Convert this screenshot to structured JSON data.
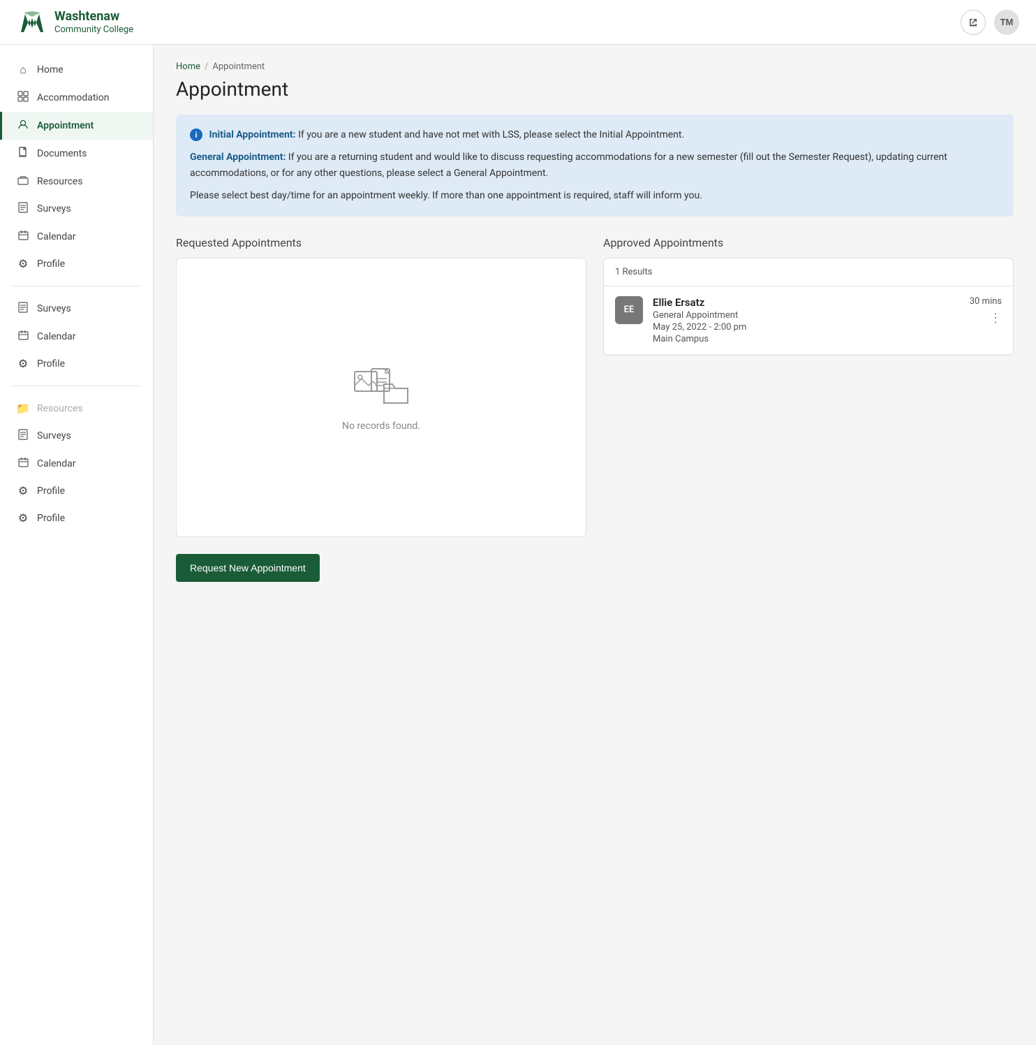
{
  "navbar": {
    "logo_line1": "Washtenaw",
    "logo_line2": "Community College",
    "avatar_initials": "TM"
  },
  "sidebar": {
    "items": [
      {
        "id": "home",
        "label": "Home",
        "icon": "🏠",
        "active": false
      },
      {
        "id": "accommodation",
        "label": "Accommodation",
        "icon": "⊞",
        "active": false
      },
      {
        "id": "appointment",
        "label": "Appointment",
        "icon": "👤",
        "active": true
      },
      {
        "id": "documents",
        "label": "Documents",
        "icon": "📄",
        "active": false
      },
      {
        "id": "resources",
        "label": "Resources",
        "icon": "📁",
        "active": false
      },
      {
        "id": "surveys",
        "label": "Surveys",
        "icon": "📋",
        "active": false
      },
      {
        "id": "calendar",
        "label": "Calendar",
        "icon": "📅",
        "active": false
      },
      {
        "id": "profile",
        "label": "Profile",
        "icon": "⚙",
        "active": false
      }
    ],
    "secondary_items": [
      {
        "id": "surveys2",
        "label": "Surveys",
        "icon": "📋"
      },
      {
        "id": "calendar2",
        "label": "Calendar",
        "icon": "📅"
      },
      {
        "id": "profile2",
        "label": "Profile",
        "icon": "⚙"
      }
    ]
  },
  "breadcrumb": {
    "home": "Home",
    "separator": "/",
    "current": "Appointment"
  },
  "page": {
    "title": "Appointment"
  },
  "info_box": {
    "icon": "i",
    "initial_appointment_label": "Initial Appointment:",
    "initial_appointment_text": " If you are a new student and have not met with LSS, please select the Initial Appointment.",
    "general_appointment_label": "General Appointment:",
    "general_appointment_text": " If you are a returning student and would like to discuss requesting accommodations for a new semester (fill out the Semester Request), updating current accommodations, or for any other questions, please select a General Appointment.",
    "note_text": "Please select best day/time for an appointment weekly. If more than one appointment is required, staff will inform you."
  },
  "requested_appointments": {
    "title": "Requested Appointments",
    "no_records_text": "No records found."
  },
  "approved_appointments": {
    "title": "Approved Appointments",
    "results_count": "1 Results",
    "card": {
      "initials": "EE",
      "name": "Ellie Ersatz",
      "type": "General Appointment",
      "date": "May 25, 2022 - 2:00 pm",
      "location": "Main Campus",
      "duration": "30 mins"
    }
  },
  "buttons": {
    "request_new_appointment": "Request New Appointment"
  }
}
